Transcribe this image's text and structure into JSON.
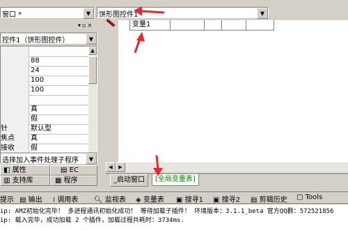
{
  "top_combo_left": "窗口 *",
  "top_combo_right": "饼形图控件1",
  "left_panel": {
    "object_combo": "控件1（饼形图控件）",
    "properties": [
      {
        "name": "",
        "value": ""
      },
      {
        "name": "",
        "value": "88"
      },
      {
        "name": "",
        "value": "24"
      },
      {
        "name": "",
        "value": "100"
      },
      {
        "name": "",
        "value": "100"
      },
      {
        "name": "",
        "value": ""
      },
      {
        "name": "",
        "value": "真"
      },
      {
        "name": "",
        "value": "假"
      },
      {
        "name": "针",
        "value": "默认型"
      },
      {
        "name": "焦点",
        "value": "真"
      },
      {
        "name": "接收",
        "value": "假"
      }
    ],
    "event_combo": "选择加入事件处理子程序",
    "tabs": {
      "property": "属性",
      "ec": "EC",
      "support": "支持库",
      "program": "程序"
    }
  },
  "editor": {
    "cell_label": "变量1",
    "tabs": [
      "_启动窗口",
      "[全局变量表]"
    ]
  },
  "bottom_tabs": [
    "提示",
    "输出",
    "调用表",
    "监视表",
    "变量表",
    "搜寻1",
    "搜寻2",
    "剪辑历史",
    "Tools"
  ],
  "output_lines": [
    "ip: AMZ初始化完毕！ 多进程通讯初始化成功！ 等待加载子插件！ 环境版本：3.1.1_beta 官方QQ群：572521856",
    "ip: 载入完毕，成功加载 2 个插件，加载过程共耗时：3734ms."
  ],
  "colors": {
    "arrow": "#e8262e",
    "editor_bg": "#ffffff"
  }
}
